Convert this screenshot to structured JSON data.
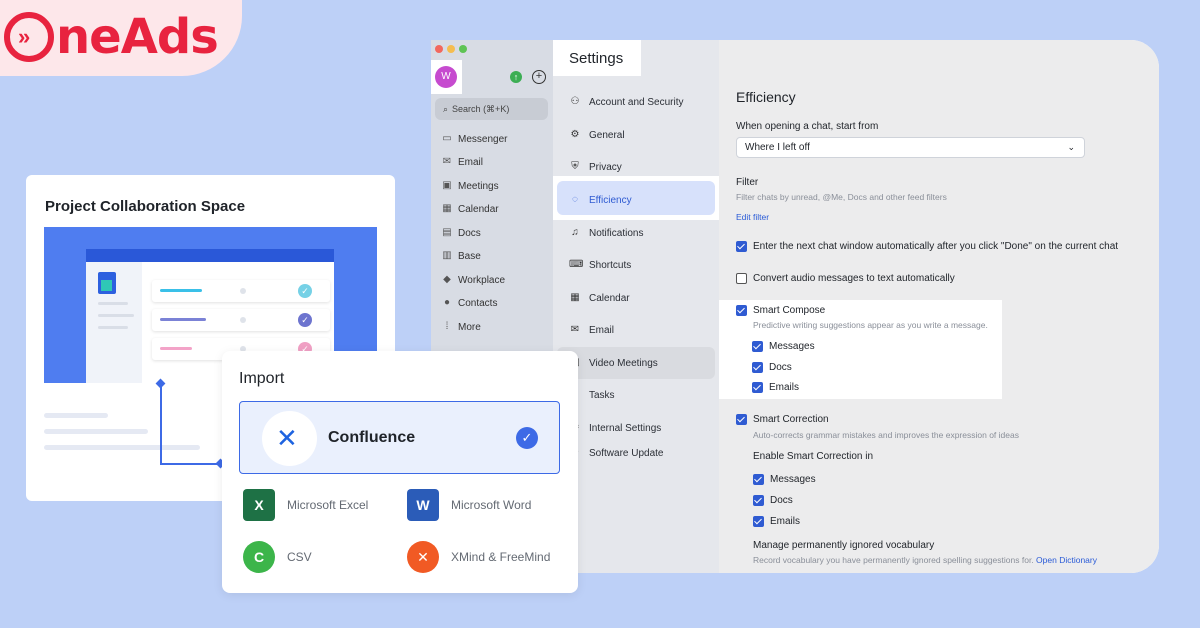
{
  "brand": {
    "logo_text": "neAds",
    "logo_full": "OneAds",
    "color": "#e8233f"
  },
  "sidebar": {
    "avatar": "W",
    "search_placeholder": "Search (⌘+K)",
    "items": [
      {
        "label": "Messenger",
        "icon": "chat-icon"
      },
      {
        "label": "Email",
        "icon": "mail-icon"
      },
      {
        "label": "Meetings",
        "icon": "video-icon"
      },
      {
        "label": "Calendar",
        "icon": "calendar-icon"
      },
      {
        "label": "Docs",
        "icon": "doc-icon"
      },
      {
        "label": "Base",
        "icon": "base-icon"
      },
      {
        "label": "Workplace",
        "icon": "workplace-icon"
      },
      {
        "label": "Contacts",
        "icon": "contacts-icon"
      },
      {
        "label": "More",
        "icon": "grid-icon"
      }
    ]
  },
  "settings": {
    "title": "Settings",
    "items": [
      {
        "label": "Account and Security",
        "icon": "person-icon"
      },
      {
        "label": "General",
        "icon": "gear-icon"
      },
      {
        "label": "Privacy",
        "icon": "shield-icon"
      },
      {
        "label": "Efficiency",
        "icon": "bulb-icon"
      },
      {
        "label": "Notifications",
        "icon": "bell-icon"
      },
      {
        "label": "Shortcuts",
        "icon": "keyboard-icon"
      },
      {
        "label": "Calendar",
        "icon": "calendar-icon"
      },
      {
        "label": "Email",
        "icon": "mail-icon"
      },
      {
        "label": "Video Meetings",
        "icon": "video-icon"
      },
      {
        "label": "Tasks",
        "icon": "check-icon"
      },
      {
        "label": "Internal Settings",
        "icon": "settings-icon"
      },
      {
        "label": "Software Update",
        "icon": "update-icon"
      }
    ],
    "active": "Efficiency"
  },
  "efficiency": {
    "heading": "Efficiency",
    "open_chat_label": "When opening a chat, start from",
    "open_chat_value": "Where I left off",
    "filter_label": "Filter",
    "filter_desc": "Filter chats by unread, @Me, Docs and other feed filters",
    "edit_filter": "Edit filter",
    "enter_next": "Enter the next chat window automatically after you click \"Done\" on the current chat",
    "convert_audio": "Convert audio messages to text automatically",
    "smart_compose": "Smart Compose",
    "smart_compose_desc": "Predictive writing suggestions appear as you write a message.",
    "compose_opts": [
      "Messages",
      "Docs",
      "Emails"
    ],
    "smart_correction": "Smart Correction",
    "smart_correction_desc": "Auto-corrects grammar mistakes and improves the expression of ideas",
    "enable_correction": "Enable Smart Correction in",
    "correction_opts": [
      "Messages",
      "Docs",
      "Emails"
    ],
    "manage_vocab": "Manage permanently ignored vocabulary",
    "vocab_desc": "Record vocabulary you have permanently ignored spelling suggestions for.",
    "open_dictionary": "Open Dictionary"
  },
  "project": {
    "title": "Project Collaboration Space"
  },
  "import": {
    "title": "Import",
    "selected": "Confluence",
    "options": [
      {
        "label": "Microsoft Excel",
        "icon": "excel-icon",
        "glyph": "X",
        "color": "#1e7145"
      },
      {
        "label": "Microsoft Word",
        "icon": "word-icon",
        "glyph": "W",
        "color": "#2b5cb8"
      },
      {
        "label": "CSV",
        "icon": "csv-icon",
        "glyph": "C",
        "color": "#3cb54a"
      },
      {
        "label": "XMind & FreeMind",
        "icon": "xmind-icon",
        "glyph": "✕",
        "color": "#f15a24"
      }
    ]
  }
}
